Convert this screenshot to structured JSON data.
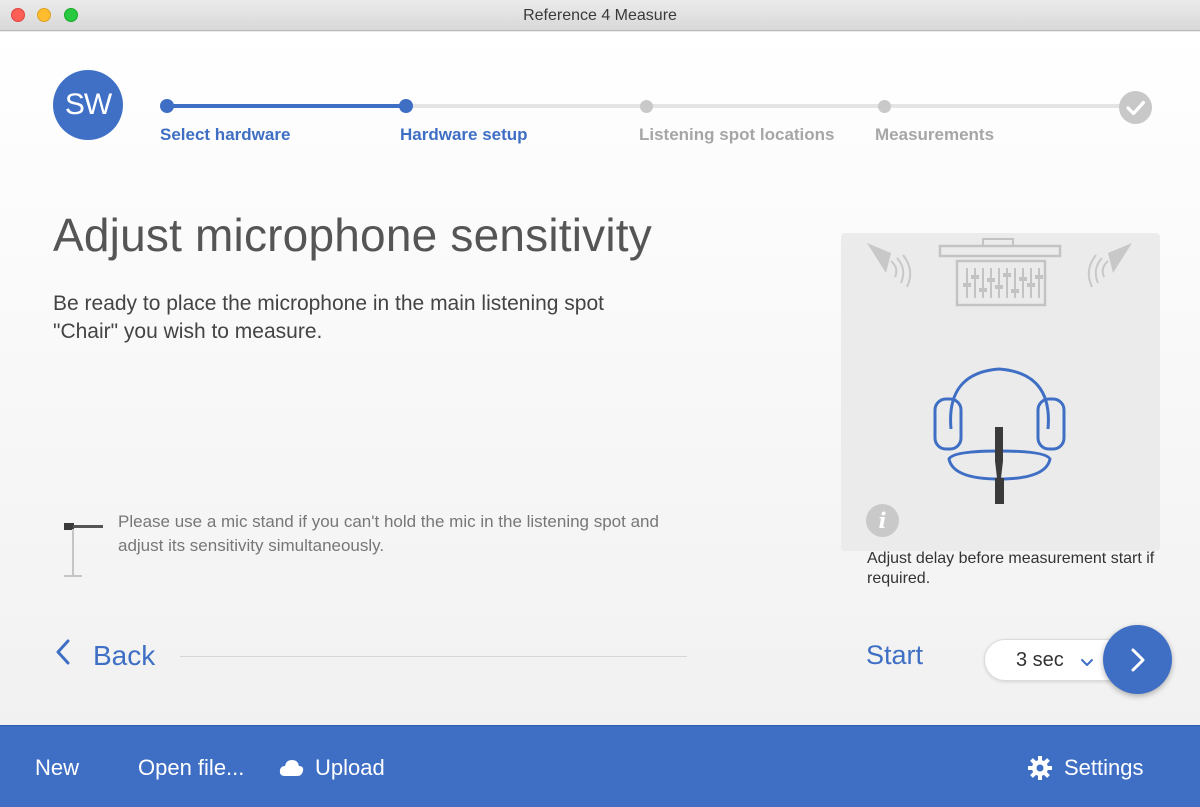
{
  "window": {
    "title": "Reference 4 Measure"
  },
  "logo": {
    "text": "SW"
  },
  "stepper": {
    "steps": [
      {
        "label": "Select hardware",
        "state": "done"
      },
      {
        "label": "Hardware setup",
        "state": "current"
      },
      {
        "label": "Listening spot locations",
        "state": "todo"
      },
      {
        "label": "Measurements",
        "state": "todo"
      }
    ],
    "final_icon": "checkmark-icon"
  },
  "content": {
    "headline": "Adjust microphone sensitivity",
    "intro": "Be ready to place the microphone in the main listening spot \"Chair\" you wish to measure.",
    "hint": "Please use a mic stand if you can't hold the mic in the listening spot and adjust its sensitivity simultaneously."
  },
  "navigation": {
    "back_label": "Back"
  },
  "illustration": {
    "icons": [
      "speaker-left-icon",
      "mixing-console-icon",
      "speaker-right-icon",
      "chair-icon",
      "microphone-icon"
    ],
    "delay_note": "Adjust delay before measurement start if required."
  },
  "start_controls": {
    "start_label": "Start",
    "delay_selected": "3 sec"
  },
  "footer": {
    "new_label": "New",
    "open_label": "Open file...",
    "upload_label": "Upload",
    "settings_label": "Settings"
  },
  "colors": {
    "accent": "#3f6fc4",
    "inactive": "#a6a6a6",
    "footer_bg": "#3f6fc4"
  }
}
